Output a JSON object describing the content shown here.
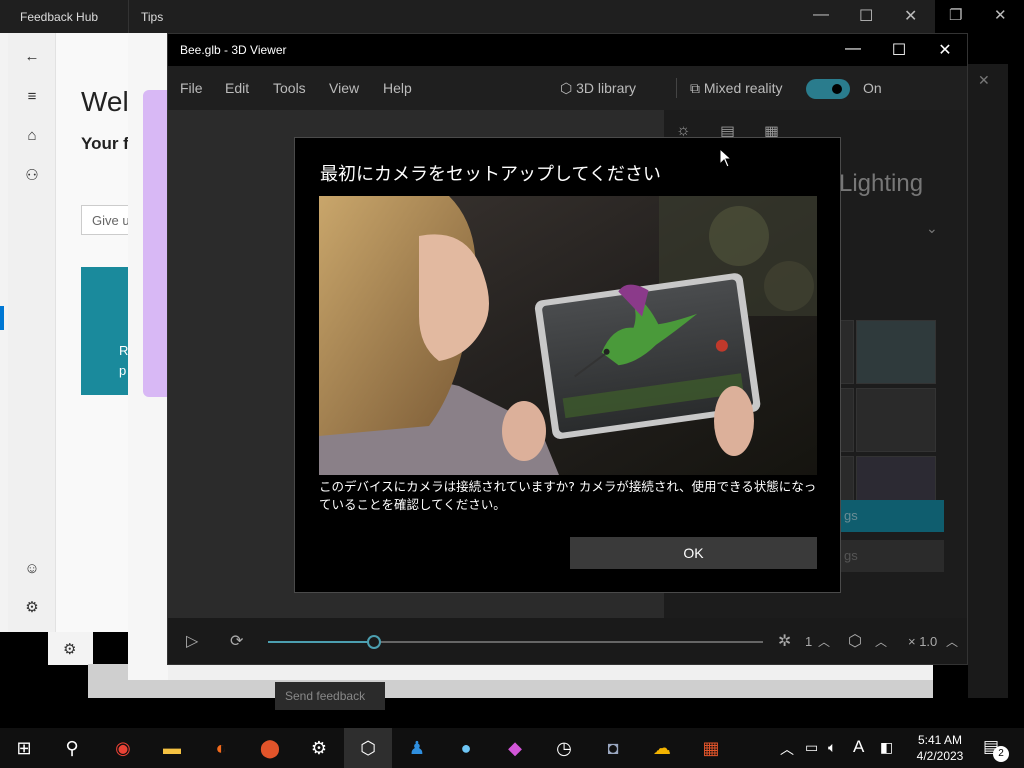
{
  "feedback_hub": {
    "title": "Feedback Hub",
    "welcome": "Wel",
    "your": "Your f",
    "give": "Give u",
    "card_line1": "R",
    "card_line2": "p"
  },
  "tips": {
    "title": "Tips",
    "send_feedback": "Send feedback"
  },
  "viewer": {
    "title": "Bee.glb - 3D Viewer",
    "menu": [
      "File",
      "Edit",
      "Tools",
      "View",
      "Help"
    ],
    "library": "3D library",
    "mixed_reality": "Mixed reality",
    "toggle_state": "On",
    "panel_heading": "Lighting",
    "panel_btn1": "gs",
    "panel_btn2": "gs",
    "speed_count": "1",
    "zoom": "× 1.0"
  },
  "dialog": {
    "title": "最初にカメラをセットアップしてください",
    "body": "このデバイスにカメラは接続されていますか? カメラが接続され、使用できる状態になっていることを確認してください。",
    "ok": "OK"
  },
  "taskbar": {
    "time": "5:41 AM",
    "date": "4/2/2023",
    "notifications": "2",
    "ime": "A"
  },
  "colors": {
    "accent": "#2a7c8d",
    "dialog_bg": "#000000",
    "ok_button": "#3a3a3a"
  }
}
